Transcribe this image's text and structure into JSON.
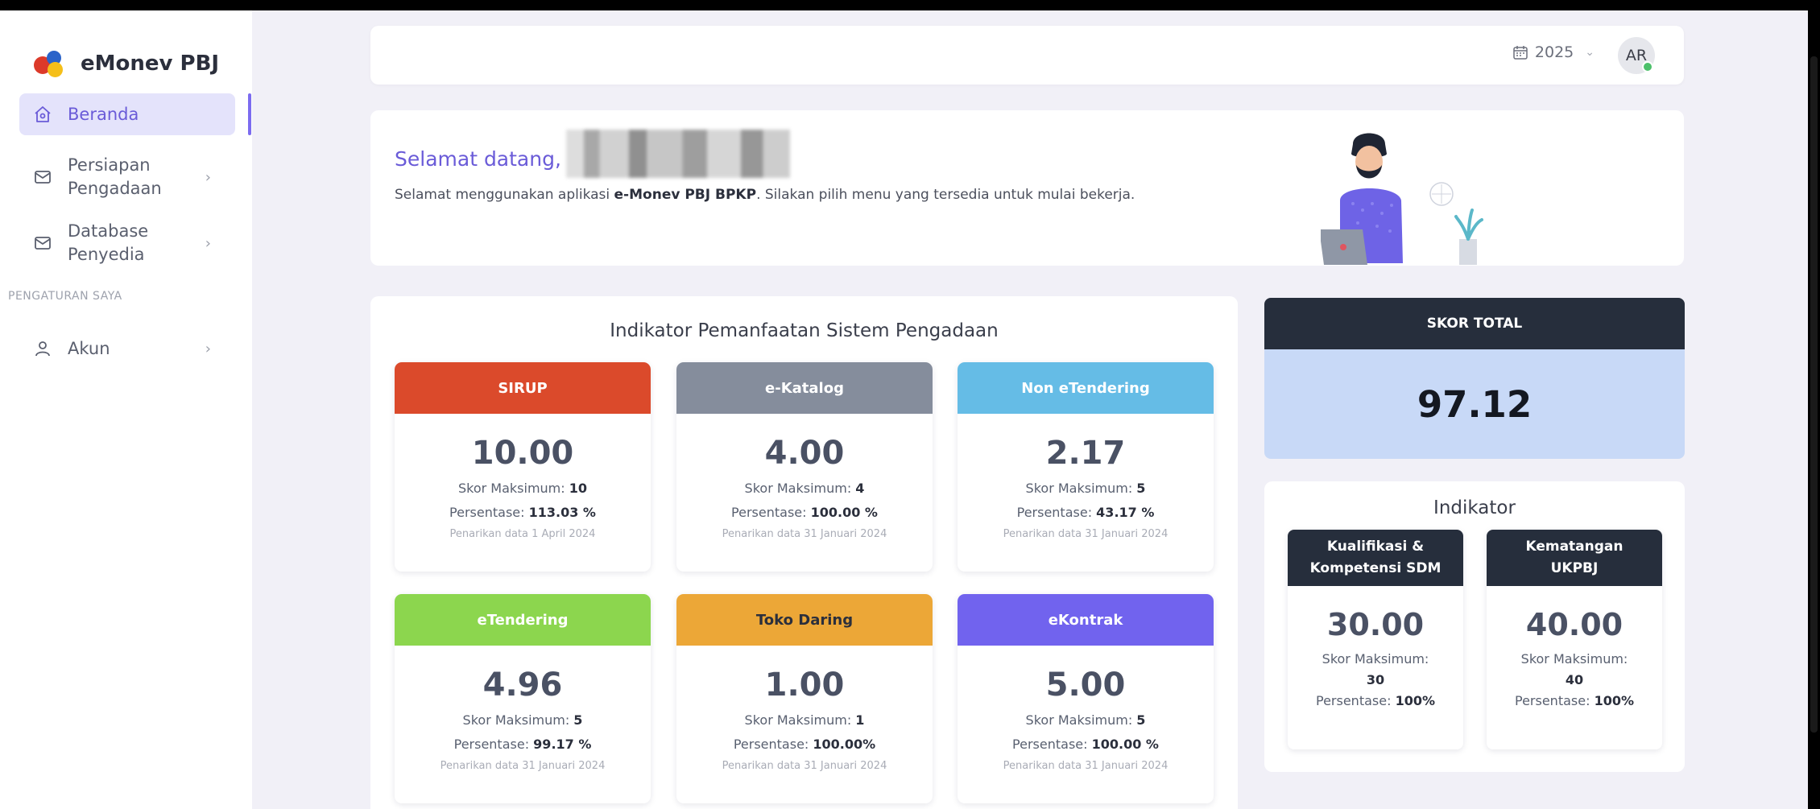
{
  "app": {
    "name": "eMonev PBJ"
  },
  "sidebar": {
    "items": [
      {
        "label": "Beranda",
        "icon": "home-icon",
        "active": true
      },
      {
        "label": "Persiapan\nPengadaan",
        "icon": "mail-icon"
      },
      {
        "label": "Database\nPenyedia",
        "icon": "mail-icon"
      }
    ],
    "section_label": "PENGATURAN SAYA",
    "account": {
      "label": "Akun",
      "icon": "user-icon"
    }
  },
  "topbar": {
    "year": "2025",
    "avatar_initials": "AR"
  },
  "welcome": {
    "title": "Selamat datang,",
    "text_before": "Selamat menggunakan aplikasi ",
    "app_bold": "e-Monev PBJ BPKP",
    "text_after": ". Silakan pilih menu yang tersedia untuk mulai bekerja."
  },
  "main": {
    "title": "Indikator Pemanfaatan Sistem Pengadaan",
    "max_label": "Skor Maksimum: ",
    "pct_label": "Persentase: ",
    "indicators": [
      {
        "name": "SIRUP",
        "value": "10.00",
        "max": "10",
        "pct": "113.03 %",
        "note": "Penarikan data 1 April 2024",
        "color": "#db4a2b"
      },
      {
        "name": "e-Katalog",
        "value": "4.00",
        "max": "4",
        "pct": "100.00 %",
        "note": "Penarikan data 31 Januari 2024",
        "color": "#858d9c"
      },
      {
        "name": "Non eTendering",
        "value": "2.17",
        "max": "5",
        "pct": "43.17 %",
        "note": "Penarikan data 31 Januari 2024",
        "color": "#65bce6"
      },
      {
        "name": "eTendering",
        "value": "4.96",
        "max": "5",
        "pct": "99.17 %",
        "note": "Penarikan data 31 Januari 2024",
        "color": "#8cd64e"
      },
      {
        "name": "Toko Daring",
        "value": "1.00",
        "max": "1",
        "pct": "100.00%",
        "note": "Penarikan data 31 Januari 2024",
        "color": "#eca737"
      },
      {
        "name": "eKontrak",
        "value": "5.00",
        "max": "5",
        "pct": "100.00 %",
        "note": "Penarikan data 31 Januari 2024",
        "color": "#7163ee"
      }
    ]
  },
  "skor_total": {
    "label": "SKOR TOTAL",
    "value": "97.12"
  },
  "indikator": {
    "title": "Indikator",
    "max_label": "Skor Maksimum:",
    "pct_label": "Persentase: ",
    "items": [
      {
        "name": "Kualifikasi &\nKompetensi SDM",
        "value": "30.00",
        "max": "30",
        "pct": "100%"
      },
      {
        "name": "Kematangan\nUKPBJ",
        "value": "40.00",
        "max": "40",
        "pct": "100%"
      }
    ]
  }
}
